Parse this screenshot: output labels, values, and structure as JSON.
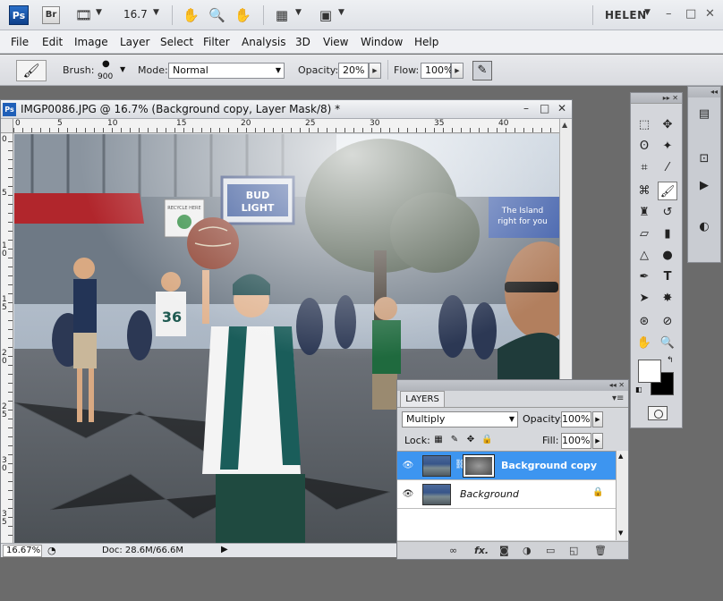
{
  "appbar": {
    "ps": "Ps",
    "br": "Br",
    "zoom": "16.7",
    "user": "HELEN"
  },
  "menu": [
    "File",
    "Edit",
    "Image",
    "Layer",
    "Select",
    "Filter",
    "Analysis",
    "3D",
    "View",
    "Window",
    "Help"
  ],
  "options": {
    "brush_label": "Brush:",
    "brush_size": "900",
    "mode_label": "Mode:",
    "mode_value": "Normal",
    "opacity_label": "Opacity:",
    "opacity_value": "20%",
    "flow_label": "Flow:",
    "flow_value": "100%"
  },
  "document": {
    "title": "IMGP0086.JPG @ 16.7% (Background copy, Layer Mask/8) *",
    "zoom": "16.67%",
    "doc_info": "Doc: 28.6M/66.6M",
    "ruler_h": [
      "0",
      "5",
      "10",
      "15",
      "20",
      "25",
      "30",
      "35",
      "40"
    ],
    "ruler_v": [
      "0",
      "5",
      "1\n0",
      "1\n5",
      "2\n0",
      "2\n5",
      "3\n0",
      "3\n5"
    ]
  },
  "photo": {
    "sign_main": "BUD LIGHT",
    "sign_recycle": "RECYCLE HERE",
    "sign_island": "The Island right for you"
  },
  "layers": {
    "tab": "LAYERS",
    "blend_mode": "Multiply",
    "opacity_label": "Opacity:",
    "opacity_value": "100%",
    "lock_label": "Lock:",
    "fill_label": "Fill:",
    "fill_value": "100%",
    "items": [
      {
        "name": "Background copy",
        "selected": true
      },
      {
        "name": "Background",
        "selected": false
      }
    ]
  },
  "colors": {
    "selection": "#3d95f0",
    "workspace": "#6b6b6b"
  }
}
